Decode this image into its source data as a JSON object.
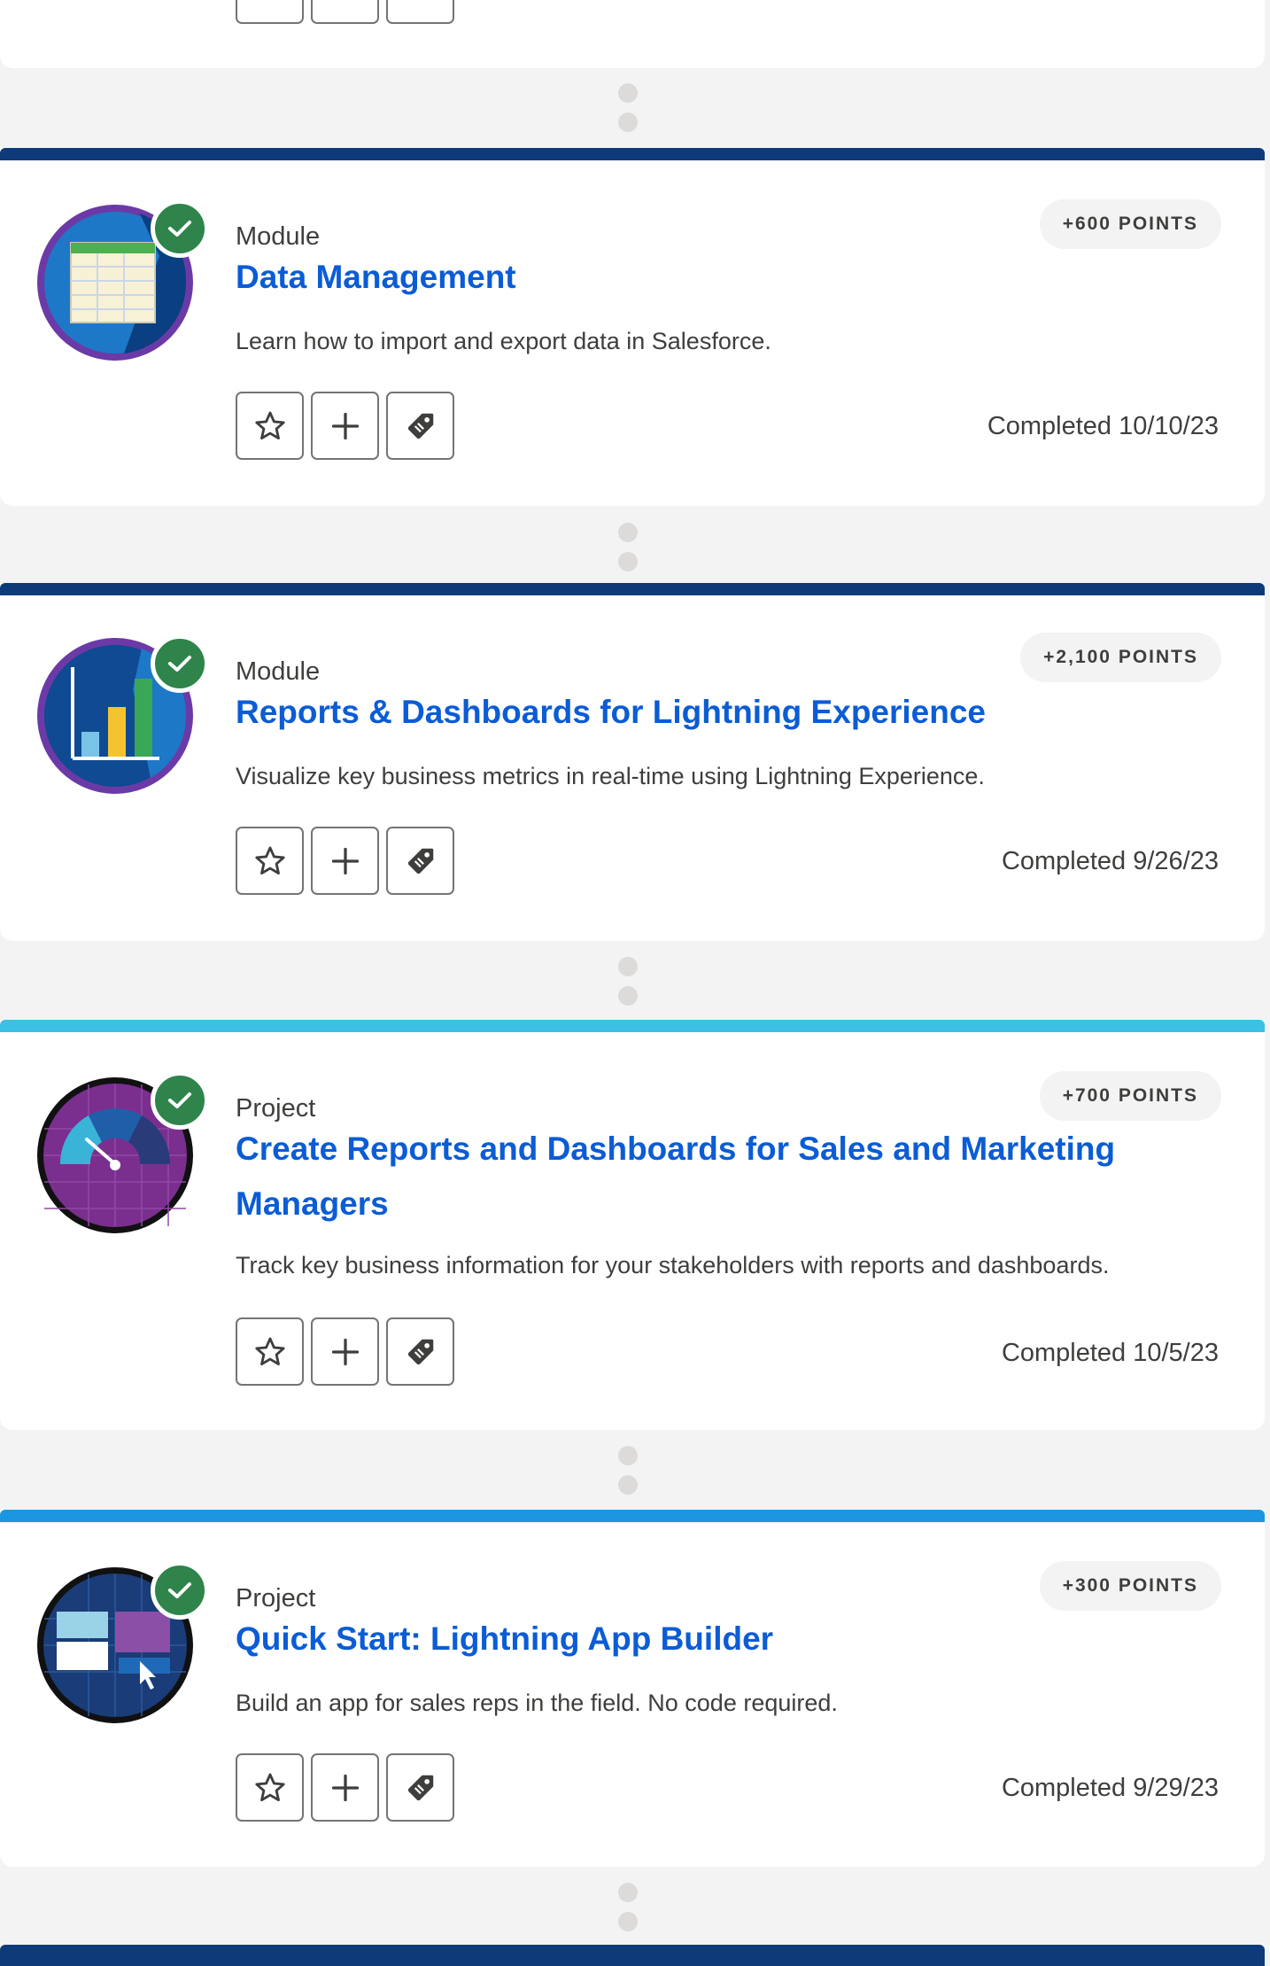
{
  "points_suffix": "POINTS",
  "completed_prefix": "Completed",
  "colors": {
    "module_bar": "#0d3b7a",
    "project_bar_1": "#3cc1e3",
    "project_bar_2": "#1b96e0",
    "link": "#0b5cd5",
    "check": "#2e844a"
  },
  "icons": {
    "favorite": "star-icon",
    "add": "plus-icon",
    "tag": "tag-icon",
    "done": "checkmark-icon"
  },
  "items": [
    {
      "type": "Module",
      "title": "Data Management",
      "description": "Learn how to import and export data in Salesforce.",
      "points": "+600 POINTS",
      "completed": "Completed 10/10/23"
    },
    {
      "type": "Module",
      "title": "Reports & Dashboards for Lightning Experience",
      "description": "Visualize key business metrics in real-time using Lightning Experience.",
      "points": "+2,100 POINTS",
      "completed": "Completed 9/26/23"
    },
    {
      "type": "Project",
      "title": "Create Reports and Dashboards for Sales and Marketing Managers",
      "description": "Track key business information for your stakeholders with reports and dashboards.",
      "points": "+700 POINTS",
      "completed": "Completed 10/5/23"
    },
    {
      "type": "Project",
      "title": "Quick Start: Lightning App Builder",
      "description": "Build an app for sales reps in the field. No code required.",
      "points": "+300 POINTS",
      "completed": "Completed 9/29/23"
    }
  ]
}
